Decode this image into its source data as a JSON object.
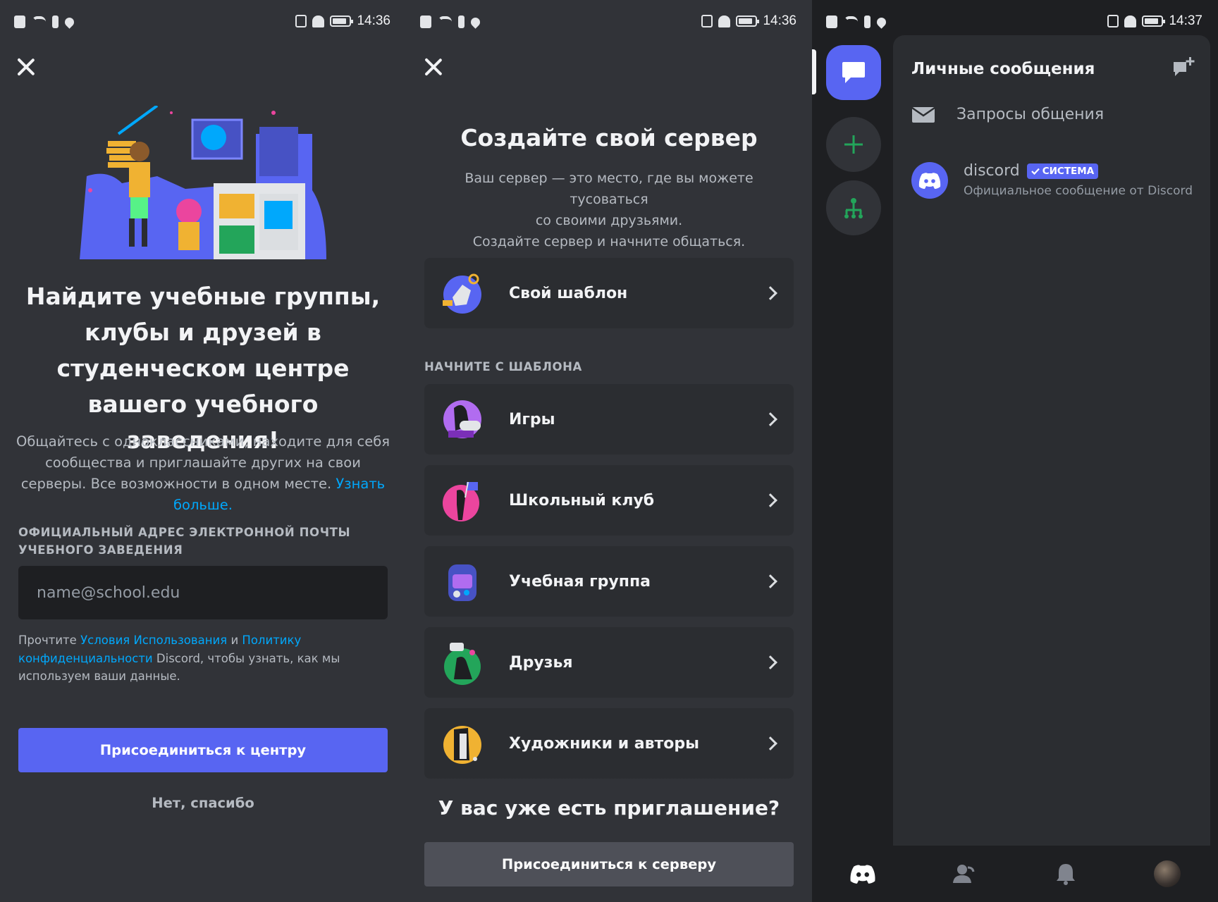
{
  "status_bars": [
    {
      "time": "14:36"
    },
    {
      "time": "14:36"
    },
    {
      "time": "14:37"
    }
  ],
  "hub": {
    "close_icon": "close-icon",
    "title": "Найдите учебные группы, клубы и друзей в студенческом центре вашего учебного заведения!",
    "desc_text": "Общайтесь с одноклассниками, находите для себя сообщества и приглашайте других на свои серверы. Все возможности в одном месте.",
    "learn_more": "Узнать больше.",
    "email_label": "ОФИЦИАЛЬНЫЙ АДРЕС ЭЛЕКТРОННОЙ ПОЧТЫ УЧЕБНОГО ЗАВЕДЕНИЯ",
    "email_placeholder": "name@school.edu",
    "terms_prefix": "Прочтите",
    "terms_link": "Условия Использования",
    "terms_and": "и",
    "privacy_link": "Политику конфиденциальности",
    "terms_suffix": "Discord, чтобы узнать, как мы используем ваши данные.",
    "join_button": "Присоединиться к центру",
    "no_thanks": "Нет, спасибо"
  },
  "create_server": {
    "close_icon": "close-icon",
    "title": "Создайте свой сервер",
    "desc_line1": "Ваш сервер — это место, где вы можете тусоваться",
    "desc_line2": "со своими друзьями.",
    "desc_line3": "Создайте сервер и начните общаться.",
    "own_template": "Свой шаблон",
    "section_label": "НАЧНИТЕ С ШАБЛОНА",
    "templates": [
      {
        "label": "Игры",
        "icon": "gaming-icon"
      },
      {
        "label": "Школьный клуб",
        "icon": "school-club-icon"
      },
      {
        "label": "Учебная группа",
        "icon": "study-group-icon"
      },
      {
        "label": "Друзья",
        "icon": "friends-icon"
      },
      {
        "label": "Художники и авторы",
        "icon": "artists-icon"
      }
    ],
    "invite_title": "У вас уже есть приглашение?",
    "join_server_button": "Присоединиться к серверу"
  },
  "dms": {
    "title": "Личные сообщения",
    "new_dm_icon": "new-message-icon",
    "requests_label": "Запросы общения",
    "discord_name": "discord",
    "system_badge": "СИСТЕМА",
    "discord_sub": "Официальное сообщение от Discord",
    "rail_icons": [
      "direct-messages-icon",
      "add-server-icon",
      "explore-servers-icon"
    ],
    "nav_icons": [
      "discord-home-icon",
      "friends-icon",
      "notifications-icon",
      "profile-avatar"
    ]
  },
  "colors": {
    "background": "#313338",
    "card": "#2b2d31",
    "dark": "#1e1f22",
    "blurple": "#5865f2",
    "link": "#00a8fc",
    "green": "#23a55a"
  }
}
